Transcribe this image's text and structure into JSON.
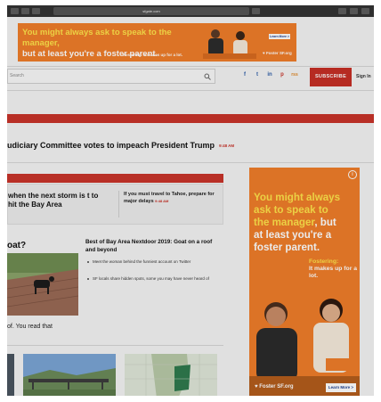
{
  "browser": {
    "url": "sfgate.com"
  },
  "top_ad": {
    "headline_line1": "You might always ask to speak to the manager,",
    "headline_line2": "but at least you're a foster parent.",
    "tagline": "Fostering: It makes up for a lot.",
    "cta": "Learn More >",
    "brand": "Foster SF.org"
  },
  "nav": {
    "search_placeholder": "Search",
    "social": [
      "f",
      "t",
      "in",
      "p",
      "rss"
    ],
    "subscribe_label": "SUBSCRIBE",
    "signin_label": "Sign In"
  },
  "breaking": {
    "headline": "udiciary Committee votes to impeach President Trump",
    "time": "9:48 AM"
  },
  "storm": {
    "headline": "when the next storm is t to hit the Bay Area",
    "detail": "If you must travel to Tahoe, prepare for major delays",
    "time": "9:48 AM"
  },
  "lower": {
    "oat_title": "oat?",
    "oat_caption": "of. You read that",
    "bestof_title": "Best of Bay Area Nextdoor 2019: Goat on a roof and beyond",
    "bullets": [
      "Meet the woman behind the funniest account on Twitter",
      "SF locals share hidden spots, some you may have never heard of"
    ]
  },
  "side_ad": {
    "line1": "You might always",
    "line2": "ask to speak to",
    "line3_a": "the manager",
    "line3_b": ", but",
    "line4": "at least you're a",
    "line5": "foster parent.",
    "sub_em": "Fostering:",
    "sub_rest": "It makes up for a lot.",
    "brand": "Foster SF.org",
    "cta": "Learn More >",
    "privacy": "i"
  },
  "colors": {
    "brand_red": "#c8342a",
    "ad_orange": "#ef7d2a",
    "ad_yellow": "#ffe24a",
    "social_blue": "#2e5ea8"
  }
}
